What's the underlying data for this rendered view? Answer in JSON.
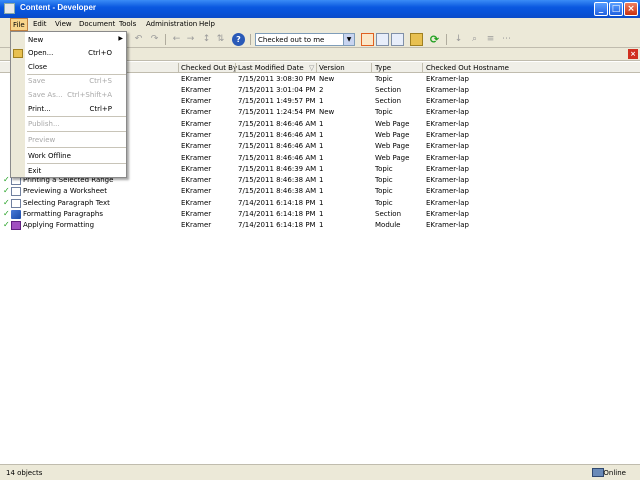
{
  "window": {
    "title": "Content - Developer"
  },
  "menu": [
    "File",
    "Edit",
    "View",
    "Document",
    "Tools",
    "Administration",
    "Help"
  ],
  "toolbar": {
    "filter_value": "Checked out to me"
  },
  "columns": [
    "Checked Out By",
    "Last Modified Date",
    "Version",
    "Type",
    "Checked Out Hostname"
  ],
  "rows": [
    {
      "name": "",
      "by": "EKramer",
      "date": "7/15/2011 3:08:30 PM",
      "version": "New",
      "type": "Topic",
      "host": "EKramer-lap"
    },
    {
      "name": "",
      "by": "EKramer",
      "date": "7/15/2011 3:01:04 PM",
      "version": "2",
      "type": "Section",
      "host": "EKramer-lap"
    },
    {
      "name": "",
      "by": "EKramer",
      "date": "7/15/2011 1:49:57 PM",
      "version": "1",
      "type": "Section",
      "host": "EKramer-lap"
    },
    {
      "name": "",
      "by": "EKramer",
      "date": "7/15/2011 1:24:54 PM",
      "version": "New",
      "type": "Topic",
      "host": "EKramer-lap"
    },
    {
      "name": "",
      "by": "EKramer",
      "date": "7/15/2011 8:46:46 AM",
      "version": "1",
      "type": "Web Page",
      "host": "EKramer-lap"
    },
    {
      "name": "",
      "by": "EKramer",
      "date": "7/15/2011 8:46:46 AM",
      "version": "1",
      "type": "Web Page",
      "host": "EKramer-lap"
    },
    {
      "name": "",
      "by": "EKramer",
      "date": "7/15/2011 8:46:46 AM",
      "version": "1",
      "type": "Web Page",
      "host": "EKramer-lap"
    },
    {
      "name": "",
      "by": "EKramer",
      "date": "7/15/2011 8:46:46 AM",
      "version": "1",
      "type": "Web Page",
      "host": "EKramer-lap"
    },
    {
      "name": "",
      "by": "EKramer",
      "date": "7/15/2011 8:46:39 AM",
      "version": "1",
      "type": "Topic",
      "host": "EKramer-lap"
    },
    {
      "name": "Printing a Selected Range",
      "by": "EKramer",
      "date": "7/15/2011 8:46:38 AM",
      "version": "1",
      "type": "Topic",
      "host": "EKramer-lap"
    },
    {
      "name": "Previewing a Worksheet",
      "by": "EKramer",
      "date": "7/15/2011 8:46:38 AM",
      "version": "1",
      "type": "Topic",
      "host": "EKramer-lap"
    },
    {
      "name": "Selecting Paragraph Text",
      "by": "EKramer",
      "date": "7/14/2011 6:14:18 PM",
      "version": "1",
      "type": "Topic",
      "host": "EKramer-lap"
    },
    {
      "name": "Formatting Paragraphs",
      "by": "EKramer",
      "date": "7/14/2011 6:14:18 PM",
      "version": "1",
      "type": "Section",
      "host": "EKramer-lap"
    },
    {
      "name": "Applying Formatting",
      "by": "EKramer",
      "date": "7/14/2011 6:14:18 PM",
      "version": "1",
      "type": "Module",
      "host": "EKramer-lap"
    }
  ],
  "file_menu": {
    "new": "New",
    "open": "Open...",
    "open_sc": "Ctrl+O",
    "close": "Close",
    "save": "Save",
    "save_sc": "Ctrl+S",
    "save_as": "Save As...",
    "save_as_sc": "Ctrl+Shift+A",
    "print": "Print...",
    "print_sc": "Ctrl+P",
    "publish": "Publish...",
    "preview": "Preview",
    "work_offline": "Work Offline",
    "exit": "Exit"
  },
  "status": {
    "count": "14 objects",
    "online": "Online"
  }
}
